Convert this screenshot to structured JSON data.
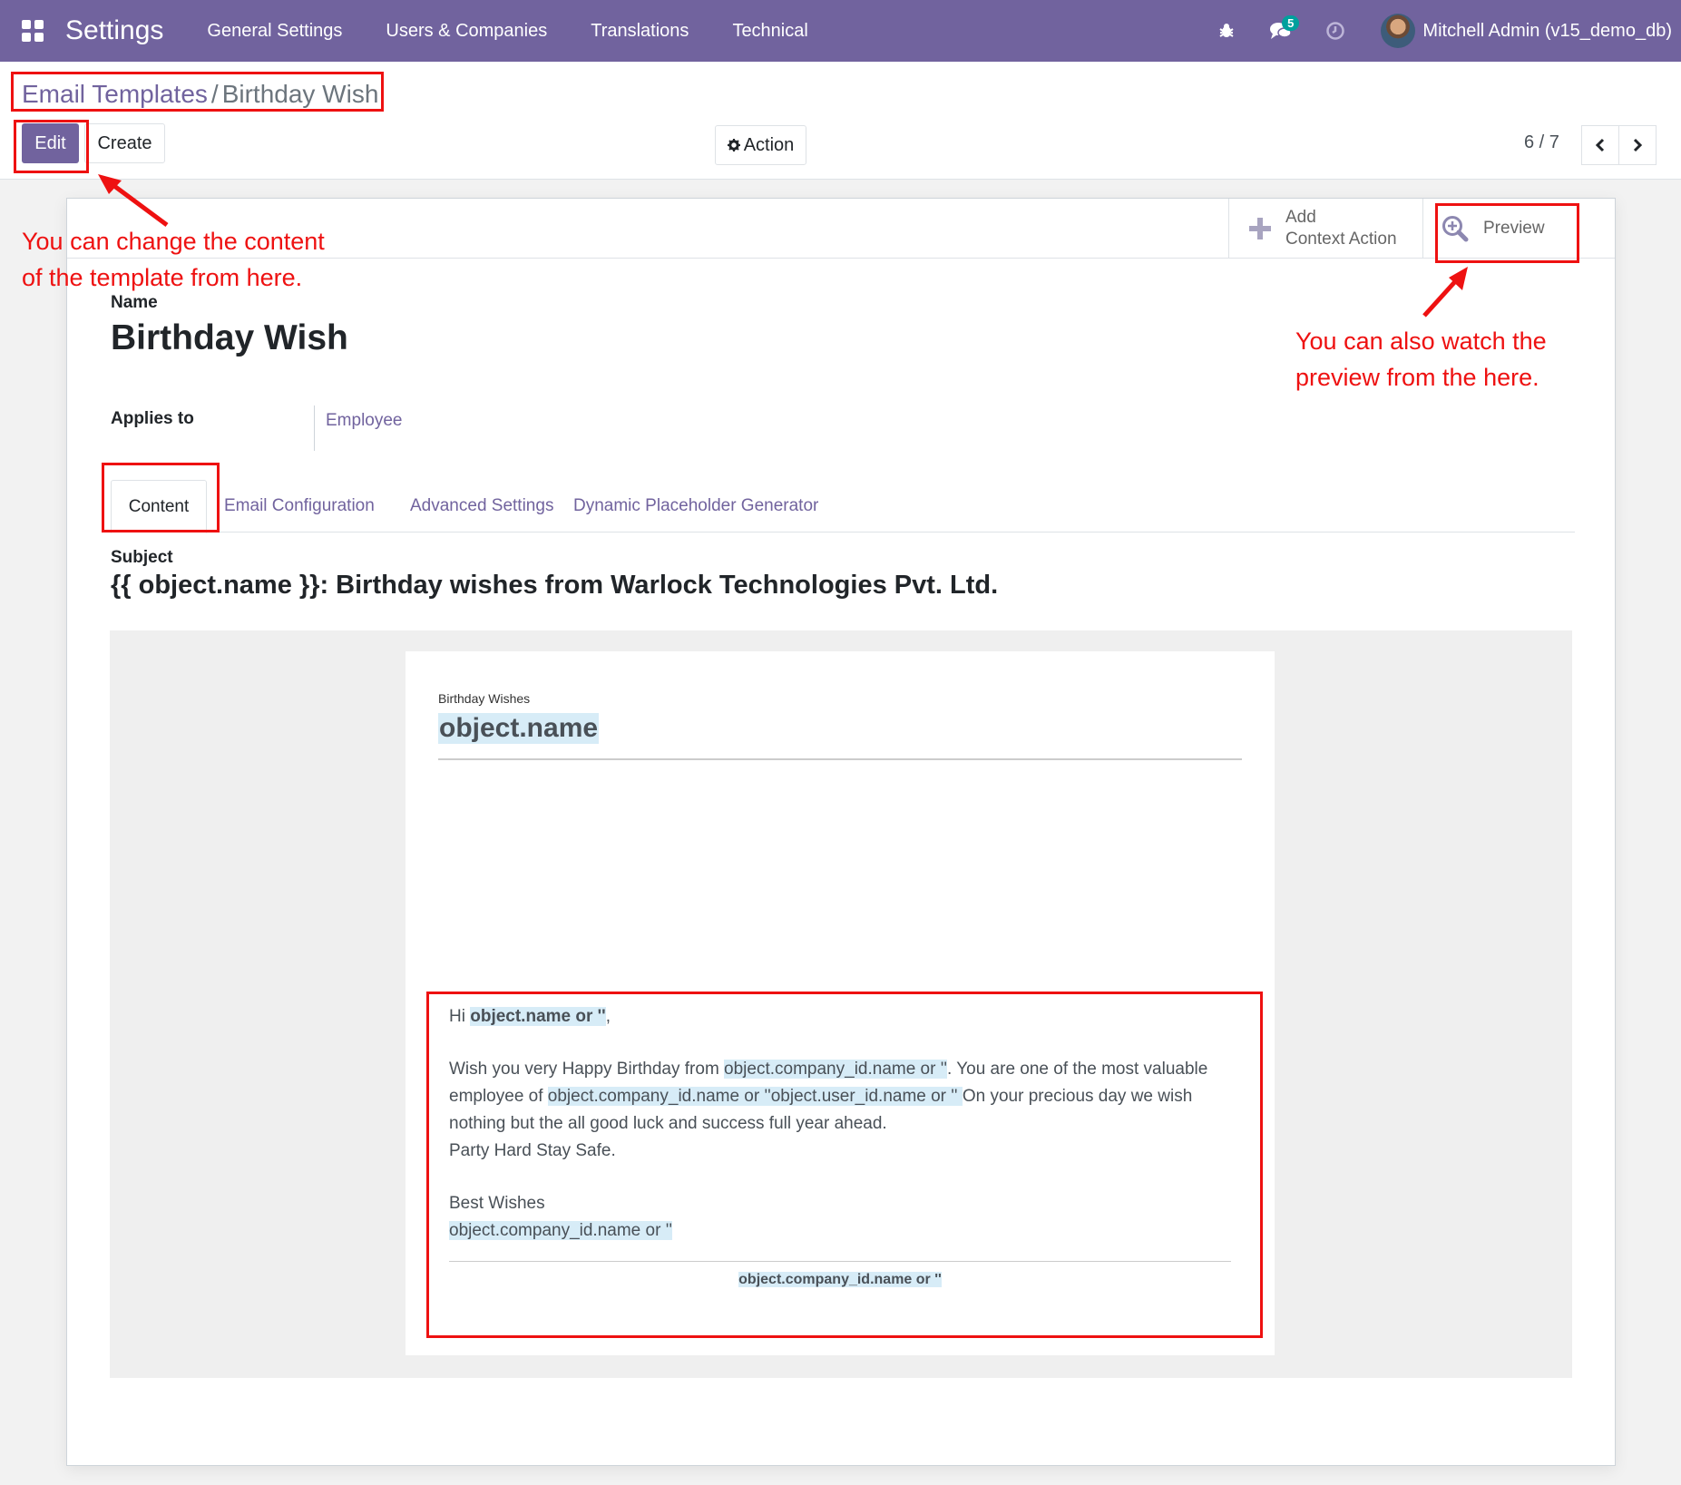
{
  "navbar": {
    "app_title": "Settings",
    "menu": [
      "General Settings",
      "Users & Companies",
      "Translations",
      "Technical"
    ],
    "messages_badge": "5",
    "user_label": "Mitchell Admin (v15_demo_db)"
  },
  "breadcrumb": {
    "parent": "Email Templates",
    "separator": "/",
    "current": "Birthday Wish"
  },
  "toolbar": {
    "edit_label": "Edit",
    "create_label": "Create",
    "action_label": "Action",
    "pager": "6 / 7"
  },
  "button_box": {
    "add_context_line1": "Add",
    "add_context_line2": "Context Action",
    "preview_label": "Preview"
  },
  "form": {
    "name_label": "Name",
    "name_value": "Birthday Wish",
    "applies_label": "Applies to",
    "applies_value": "Employee",
    "tabs": [
      "Content",
      "Email Configuration",
      "Advanced Settings",
      "Dynamic Placeholder Generator"
    ],
    "subject_label": "Subject",
    "subject_value": "{{ object.name }}: Birthday wishes from Warlock Technologies Pvt. Ltd."
  },
  "mail": {
    "kicker": "Birthday Wishes",
    "heading": "object.name",
    "greeting_prefix": "Hi ",
    "greeting_name": "object.name or ''",
    "greeting_suffix": ",",
    "p1_a": "Wish you very Happy Birthday from ",
    "p1_b": "object.company_id.name or ''",
    "p1_c": ". You are one of the most valuable employee of ",
    "p1_d": "object.company_id.name or ''object.user_id.name or '' ",
    "p1_e": "On your precious day we wish nothing but the all good luck and success full year ahead.",
    "p1_f": "Party Hard Stay Safe.",
    "closing": "Best Wishes",
    "signature": "object.company_id.name or ''",
    "footer": "object.company_id.name or ''"
  },
  "annotations": {
    "left_note_line1": "You can change the content",
    "left_note_line2": "of the template from here.",
    "right_note_line1": "You can also watch the",
    "right_note_line2": "preview from the here."
  },
  "colors": {
    "brand": "#71639e",
    "annotation": "#ee1111",
    "placeholder_highlight": "#d7ecf7"
  }
}
